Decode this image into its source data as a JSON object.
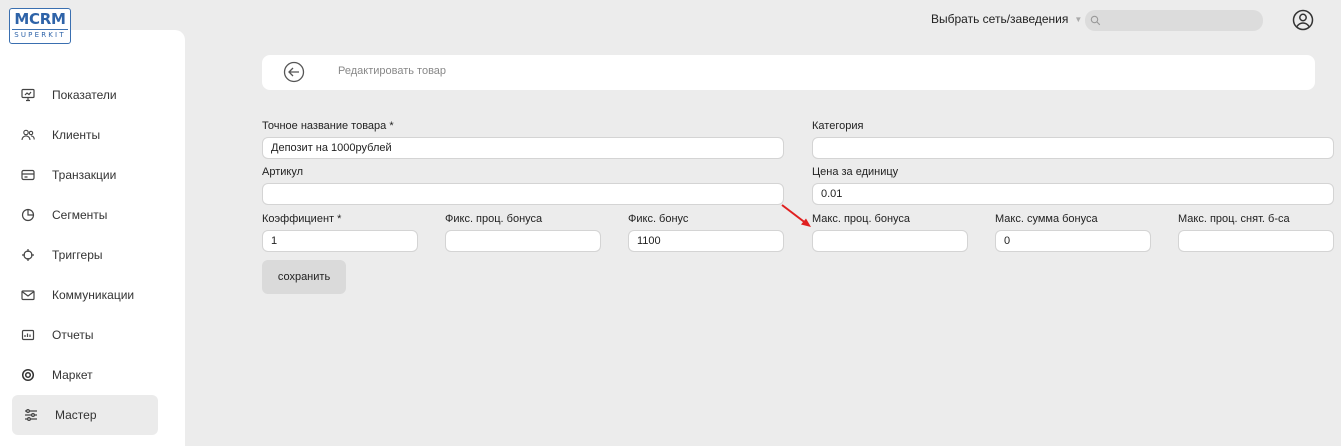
{
  "logo": {
    "main": "MCRM",
    "sub": "SUPERKIT"
  },
  "sidebar": {
    "items": [
      {
        "label": "Показатели",
        "icon": "monitor-icon"
      },
      {
        "label": "Клиенты",
        "icon": "users-icon"
      },
      {
        "label": "Транзакции",
        "icon": "card-icon"
      },
      {
        "label": "Сегменты",
        "icon": "pie-icon"
      },
      {
        "label": "Триггеры",
        "icon": "target-icon"
      },
      {
        "label": "Коммуникации",
        "icon": "mail-icon"
      },
      {
        "label": "Отчеты",
        "icon": "report-icon"
      },
      {
        "label": "Маркет",
        "icon": "market-icon"
      },
      {
        "label": "Мастер",
        "icon": "sliders-icon",
        "active": true
      }
    ]
  },
  "header": {
    "network_select": "Выбрать сеть/заведения",
    "search_placeholder": ""
  },
  "page": {
    "title": "Редактировать товар"
  },
  "form": {
    "name": {
      "label": "Точное название товара *",
      "value": "Депозит на 1000рублей"
    },
    "category": {
      "label": "Категория",
      "value": ""
    },
    "article": {
      "label": "Артикул",
      "value": ""
    },
    "price": {
      "label": "Цена за единицу",
      "value": "0.01"
    },
    "coefficient": {
      "label": "Коэффициент *",
      "value": "1"
    },
    "fixed_bonus_pct": {
      "label": "Фикс. проц. бонуса",
      "value": ""
    },
    "fixed_bonus": {
      "label": "Фикс. бонус",
      "value": "1100"
    },
    "max_bonus_pct": {
      "label": "Макс. проц. бонуса",
      "value": ""
    },
    "max_bonus_sum": {
      "label": "Макс. сумма бонуса",
      "value": "0"
    },
    "max_writeoff_pct": {
      "label": "Макс. проц. снят. б-са",
      "value": ""
    }
  },
  "save_label": "сохранить",
  "colors": {
    "annotation_arrow": "#e02020",
    "brand": "#2e63a8"
  }
}
